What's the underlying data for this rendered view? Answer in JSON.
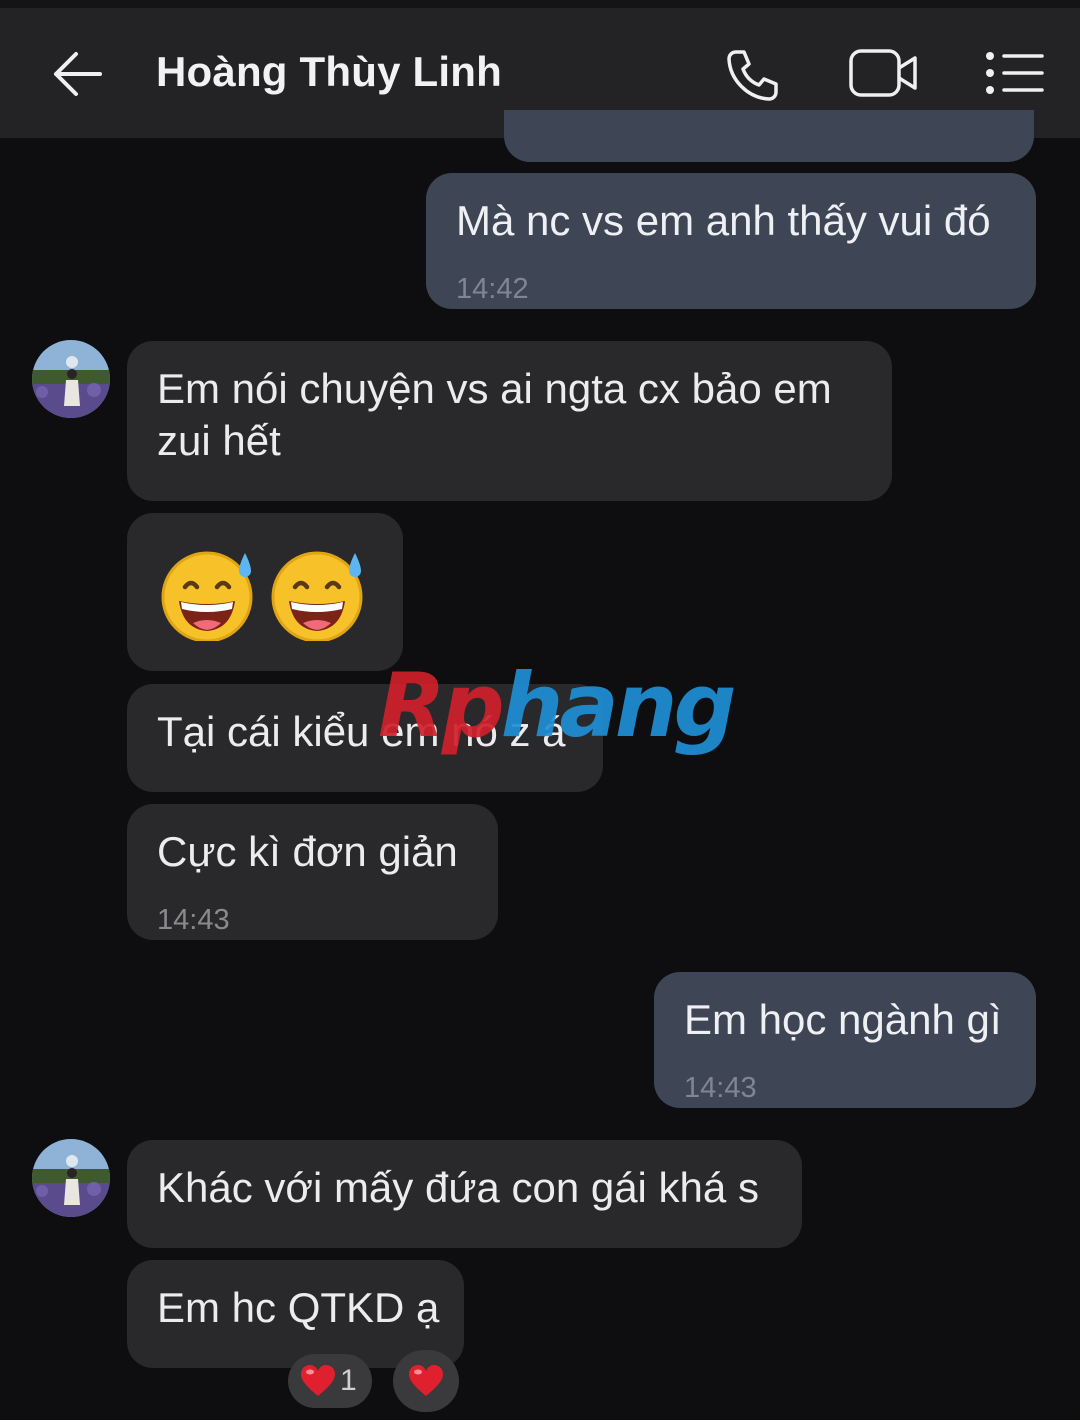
{
  "header": {
    "title": "Hoàng Thùy Linh",
    "back_icon": "arrow-left-icon",
    "call_icon": "phone-icon",
    "video_icon": "video-camera-icon",
    "menu_icon": "list-menu-icon"
  },
  "colors": {
    "header_bg": "#232325",
    "chat_bg": "#0e0e10",
    "outgoing_bubble": "#3e4554",
    "incoming_bubble": "#29292b",
    "reaction_bg": "#3a3a3d",
    "heart": "#e0202e"
  },
  "messages": [
    {
      "direction": "out",
      "text": "Mà nc vs em anh thấy vui đó",
      "time": "14:42"
    },
    {
      "direction": "in",
      "text_line1": "Em nói chuyện vs ai ngta cx bảo em",
      "text_line2": "zui hết"
    },
    {
      "direction": "in",
      "emoji": "😅😅",
      "emoji_icon": "grinning-sweat-emoji"
    },
    {
      "direction": "in",
      "text": "Tại cái kiểu em nó z á"
    },
    {
      "direction": "in",
      "text": "Cực kì đơn giản",
      "time": "14:43"
    },
    {
      "direction": "out",
      "text": "Em học ngành gì",
      "time": "14:43"
    },
    {
      "direction": "in",
      "text": "Khác với mấy đứa con gái khá s"
    },
    {
      "direction": "in",
      "text": "Em hc QTKD ạ"
    }
  ],
  "reactions": [
    {
      "icon": "heart-icon",
      "count": "1"
    },
    {
      "icon": "heart-icon"
    }
  ],
  "watermark": {
    "part1": "Rp",
    "part2": "hang"
  }
}
